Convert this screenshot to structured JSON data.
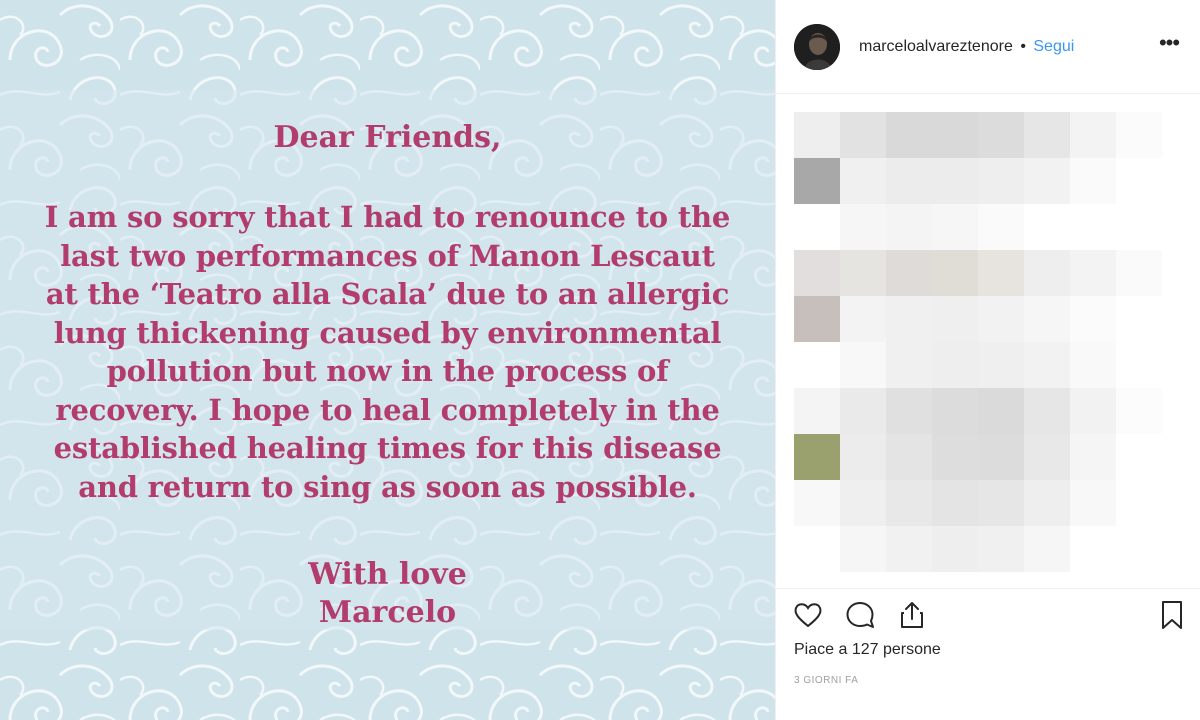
{
  "post": {
    "letter": {
      "greeting": "Dear Friends,",
      "lines": [
        "I am so sorry that I had to renounce to the",
        "last two performances of Manon Lescaut",
        "at the ‘Teatro alla Scala’ due to an allergic",
        "lung thickening caused by environmental",
        "pollution but now in the process of",
        "recovery. I hope to heal completely in the",
        "established healing times for this disease",
        "and return to sing as soon as possible."
      ],
      "closing": "With love",
      "signature": "Marcelo"
    },
    "colors": {
      "letter_text": "#b23c6b",
      "background": "#cfe3ea",
      "pattern": "#f2f7f9"
    }
  },
  "header": {
    "username": "marceloalvareztenore",
    "separator": "•",
    "follow_label": "Segui",
    "more_icon": "more-options-icon"
  },
  "comments": {
    "state": "pixelated"
  },
  "actions": {
    "icons": [
      "heart-icon",
      "comment-icon",
      "share-icon",
      "bookmark-icon"
    ],
    "likes_text": "Piace a 127 persone",
    "timestamp": "3 GIORNI FA"
  },
  "colors": {
    "link": "#3897f0",
    "text": "#262626",
    "muted": "#a0a0a0"
  }
}
